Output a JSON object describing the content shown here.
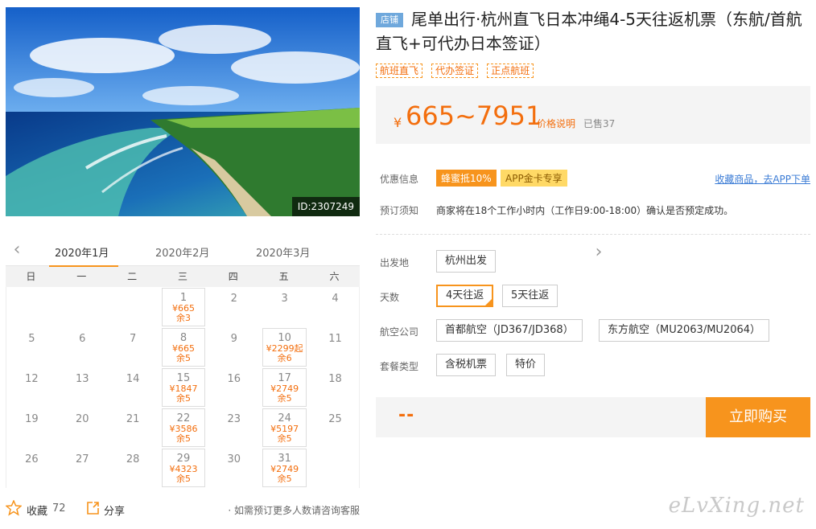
{
  "image": {
    "id_label": "ID:2307249"
  },
  "calendar": {
    "months": [
      "2020年1月",
      "2020年2月",
      "2020年3月"
    ],
    "weekdays": [
      "日",
      "一",
      "二",
      "三",
      "四",
      "五",
      "六"
    ],
    "days": [
      {
        "d": "",
        "p": "",
        "s": ""
      },
      {
        "d": "",
        "p": "",
        "s": ""
      },
      {
        "d": "",
        "p": "",
        "s": ""
      },
      {
        "d": "1",
        "p": "¥665",
        "s": "余3"
      },
      {
        "d": "2",
        "p": "",
        "s": ""
      },
      {
        "d": "3",
        "p": "",
        "s": ""
      },
      {
        "d": "4",
        "p": "",
        "s": ""
      },
      {
        "d": "5",
        "p": "",
        "s": ""
      },
      {
        "d": "6",
        "p": "",
        "s": ""
      },
      {
        "d": "7",
        "p": "",
        "s": ""
      },
      {
        "d": "8",
        "p": "¥665",
        "s": "余5"
      },
      {
        "d": "9",
        "p": "",
        "s": ""
      },
      {
        "d": "10",
        "p": "¥2299起",
        "s": "余6"
      },
      {
        "d": "11",
        "p": "",
        "s": ""
      },
      {
        "d": "12",
        "p": "",
        "s": ""
      },
      {
        "d": "13",
        "p": "",
        "s": ""
      },
      {
        "d": "14",
        "p": "",
        "s": ""
      },
      {
        "d": "15",
        "p": "¥1847",
        "s": "余5"
      },
      {
        "d": "16",
        "p": "",
        "s": ""
      },
      {
        "d": "17",
        "p": "¥2749",
        "s": "余5"
      },
      {
        "d": "18",
        "p": "",
        "s": ""
      },
      {
        "d": "19",
        "p": "",
        "s": ""
      },
      {
        "d": "20",
        "p": "",
        "s": ""
      },
      {
        "d": "21",
        "p": "",
        "s": ""
      },
      {
        "d": "22",
        "p": "¥3586",
        "s": "余5"
      },
      {
        "d": "23",
        "p": "",
        "s": ""
      },
      {
        "d": "24",
        "p": "¥5197",
        "s": "余5"
      },
      {
        "d": "25",
        "p": "",
        "s": ""
      },
      {
        "d": "26",
        "p": "",
        "s": ""
      },
      {
        "d": "27",
        "p": "",
        "s": ""
      },
      {
        "d": "28",
        "p": "",
        "s": ""
      },
      {
        "d": "29",
        "p": "¥4323",
        "s": "余5"
      },
      {
        "d": "30",
        "p": "",
        "s": ""
      },
      {
        "d": "31",
        "p": "¥2749",
        "s": "余5"
      },
      {
        "d": "",
        "p": "",
        "s": ""
      }
    ]
  },
  "footer": {
    "fav_label": "收藏",
    "fav_count": "72",
    "share_label": "分享",
    "tip": "· 如需预订更多人数请咨询客服"
  },
  "product": {
    "shop_badge": "店铺",
    "title": "尾单出行·杭州直飞日本冲绳4-5天往返机票（东航/首航直飞+可代办日本签证）",
    "tags": [
      "航班直飞",
      "代办签证",
      "正点航班"
    ],
    "yen": "¥",
    "price_range": "665~7951",
    "price_note": "价格说明",
    "sold": "已售37"
  },
  "promo": {
    "label": "优惠信息",
    "badge1": "蜂蜜抵10%",
    "badge2": "APP金卡专享",
    "app_link": "收藏商品，去APP下单"
  },
  "notice": {
    "label": "预订须知",
    "text": "商家将在18个工作小时内（工作日9:00-18:00）确认是否预定成功。"
  },
  "options": {
    "departure_label": "出发地",
    "departure": "杭州出发",
    "days_label": "天数",
    "days": [
      "4天往返",
      "5天往返"
    ],
    "airline_label": "航空公司",
    "airlines": [
      "首都航空（JD367/JD368）",
      "东方航空（MU2063/MU2064）"
    ],
    "package_label": "套餐类型",
    "packages": [
      "含税机票",
      "特价"
    ]
  },
  "buy": {
    "dash": "--",
    "button": "立即购买"
  },
  "watermark": "eLvXing.net",
  "colors": {
    "accent": "#f7941d",
    "price": "#f36e0d",
    "link": "#3a7bd5"
  }
}
